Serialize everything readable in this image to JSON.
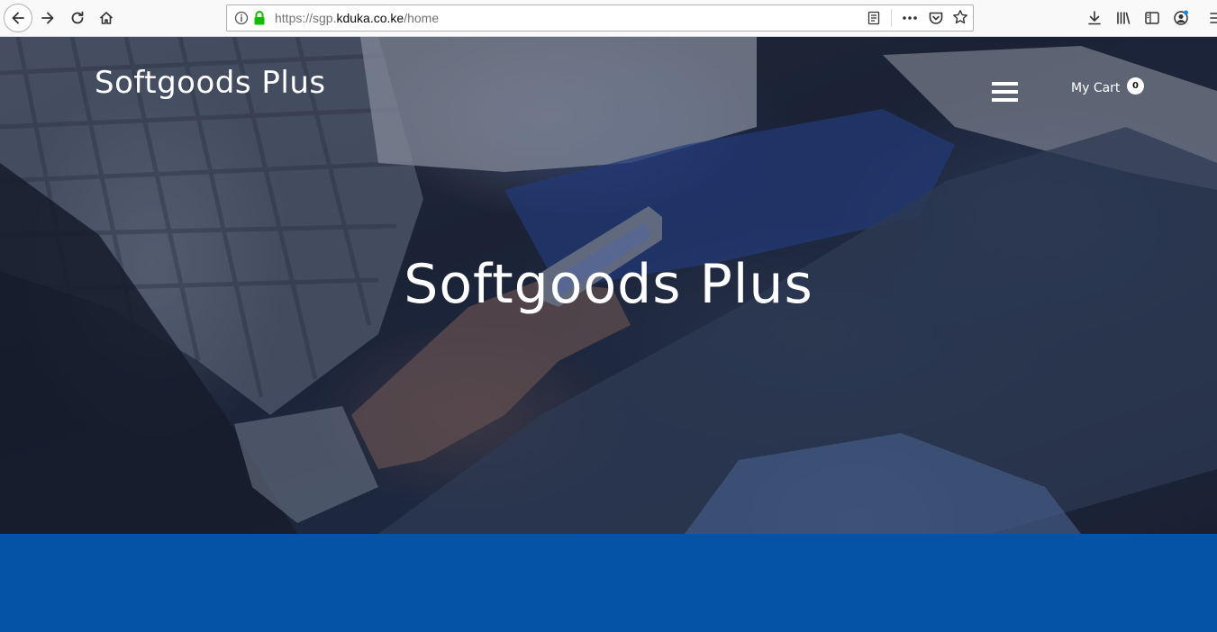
{
  "browser": {
    "url_prefix": "https://sgp.",
    "url_domain": "kduka.co.ke",
    "url_path": "/home",
    "icons": [
      "back-icon",
      "forward-icon",
      "reload-icon",
      "home-icon",
      "info-icon",
      "lock-icon",
      "reader-view-icon",
      "more-actions-icon",
      "pocket-icon",
      "bookmark-star-icon",
      "download-icon",
      "library-icon",
      "sidebar-icon",
      "account-icon",
      "menu-icon"
    ],
    "colors": {
      "lock": "#12bc00",
      "account_dot": "#0a84ff"
    }
  },
  "header": {
    "brand": "Softgoods Plus",
    "cart_label": "My Cart",
    "cart_count": "0"
  },
  "hero": {
    "title": "Softgoods Plus"
  },
  "colors": {
    "band": "#0453a6",
    "hero_overlay": "#1c2438"
  }
}
